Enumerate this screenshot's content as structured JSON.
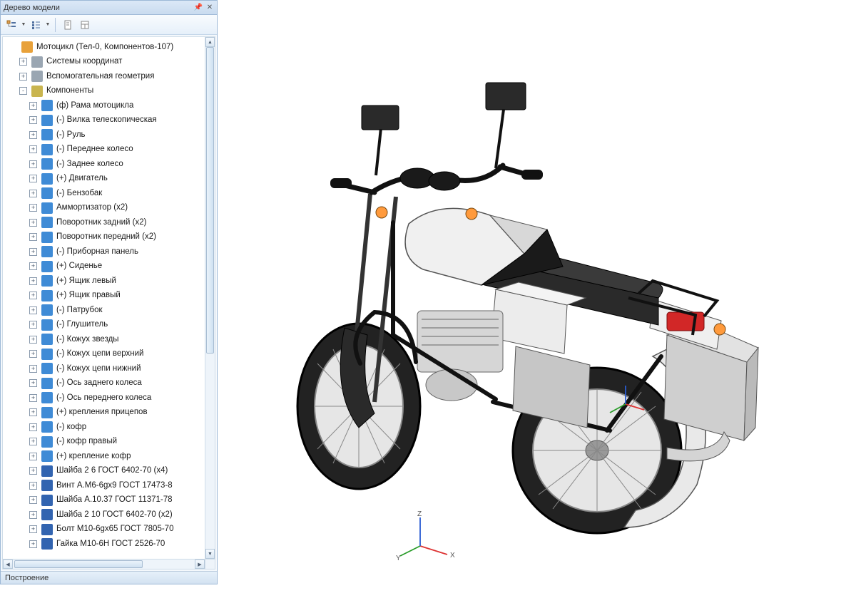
{
  "panel": {
    "title": "Дерево модели"
  },
  "toolbar": {
    "icons": [
      "tree-display-icon",
      "list-display-icon",
      "page-icon",
      "layout-icon"
    ]
  },
  "tree": {
    "root": "Мотоцикл (Тел-0, Компонентов-107)",
    "top": [
      {
        "label": "Системы координат",
        "icon": "ic-axis"
      },
      {
        "label": "Вспомогательная геометрия",
        "icon": "ic-axis"
      }
    ],
    "components_label": "Компоненты",
    "components": [
      {
        "label": "(ф) Рама мотоцикла",
        "icon": "ic-part"
      },
      {
        "label": "(-) Вилка телескопическая",
        "icon": "ic-part"
      },
      {
        "label": "(-) Руль",
        "icon": "ic-part"
      },
      {
        "label": "(-) Переднее колесо",
        "icon": "ic-part"
      },
      {
        "label": "(-) Заднее колесо",
        "icon": "ic-part"
      },
      {
        "label": "(+) Двигатель",
        "icon": "ic-part"
      },
      {
        "label": "(-) Бензобак",
        "icon": "ic-part"
      },
      {
        "label": "Аммортизатор (x2)",
        "icon": "ic-part"
      },
      {
        "label": "Поворотник задний (x2)",
        "icon": "ic-part"
      },
      {
        "label": "Поворотник передний (x2)",
        "icon": "ic-part"
      },
      {
        "label": "(-) Приборная панель",
        "icon": "ic-part"
      },
      {
        "label": "(+) Сиденье",
        "icon": "ic-part"
      },
      {
        "label": "(+) Ящик левый",
        "icon": "ic-part"
      },
      {
        "label": "(+) Ящик правый",
        "icon": "ic-part"
      },
      {
        "label": "(-) Патрубок",
        "icon": "ic-part"
      },
      {
        "label": "(-) Глушитель",
        "icon": "ic-part"
      },
      {
        "label": "(-) Кожух звезды",
        "icon": "ic-part"
      },
      {
        "label": "(-) Кожух цепи верхний",
        "icon": "ic-part"
      },
      {
        "label": "(-) Кожух цепи нижний",
        "icon": "ic-part"
      },
      {
        "label": "(-) Ось заднего колеса",
        "icon": "ic-part"
      },
      {
        "label": "(-) Ось переднего колеса",
        "icon": "ic-part"
      },
      {
        "label": "(+) крепления прицепов",
        "icon": "ic-part"
      },
      {
        "label": "(-) кофр",
        "icon": "ic-part"
      },
      {
        "label": "(-) кофр правый",
        "icon": "ic-part"
      },
      {
        "label": "(+) крепление кофр",
        "icon": "ic-part"
      },
      {
        "label": "Шайба 2 6  ГОСТ 6402-70 (x4)",
        "icon": "ic-stdpart"
      },
      {
        "label": "Винт A.M6-6gx9 ГОСТ 17473-8",
        "icon": "ic-stdpart"
      },
      {
        "label": "Шайба A.10.37 ГОСТ 11371-78",
        "icon": "ic-stdpart"
      },
      {
        "label": "Шайба 2 10  ГОСТ 6402-70 (x2)",
        "icon": "ic-stdpart"
      },
      {
        "label": "Болт M10-6gx65 ГОСТ 7805-70",
        "icon": "ic-stdpart"
      },
      {
        "label": "Гайка M10-6H ГОСТ 2526-70",
        "icon": "ic-stdpart"
      }
    ]
  },
  "status": "Построение",
  "gizmo": {
    "x": "X",
    "y": "Y",
    "z": "Z"
  }
}
